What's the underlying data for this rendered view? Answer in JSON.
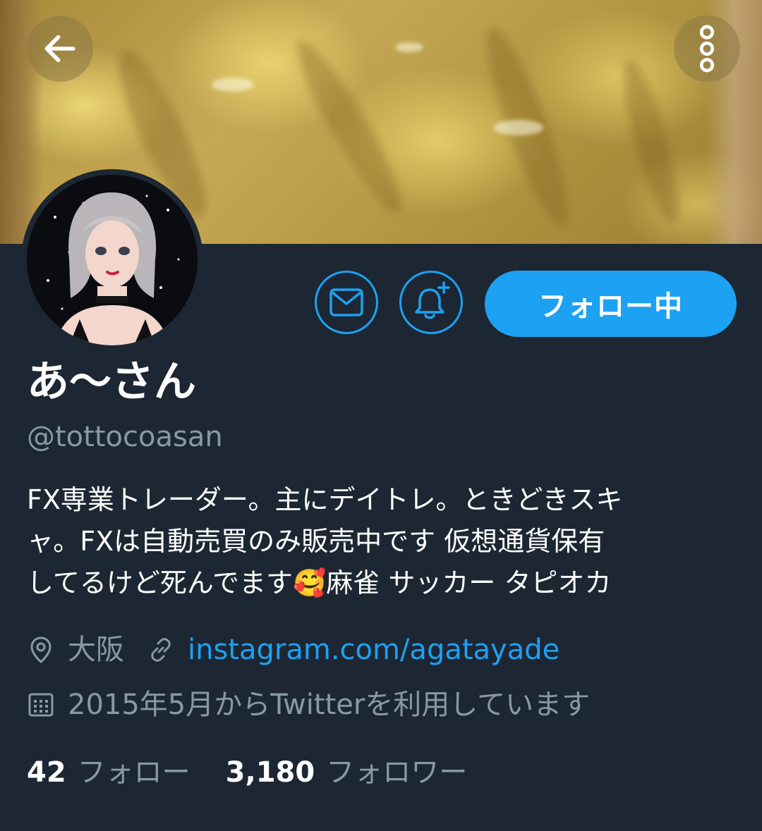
{
  "header": {
    "back_icon": "arrow-left-icon",
    "more_icon": "more-vertical-icon"
  },
  "profile": {
    "name": "あ〜さん",
    "handle": "@tottocoasan",
    "bio_line1": "FX専業トレーダー。主にデイトレ。ときどきスキ",
    "bio_line2": "ャ。FXは自動売買のみ販売中です 仮想通貨保有",
    "bio_line3a": "してるけど死んでます",
    "bio_emoji": "🥰",
    "bio_line3b": "麻雀 サッカー タピオカ",
    "location": "大阪",
    "website": "instagram.com/agatayade",
    "joined": "2015年5月からTwitterを利用しています"
  },
  "actions": {
    "message_icon": "mail-icon",
    "notify_icon": "bell-plus-icon",
    "follow_label": "フォロー中"
  },
  "stats": {
    "following_count": "42",
    "following_label": "フォロー",
    "followers_count": "3,180",
    "followers_label": "フォロワー"
  },
  "colors": {
    "background": "#1c2733",
    "accent": "#1da1f2",
    "secondary_text": "#8899a6"
  }
}
